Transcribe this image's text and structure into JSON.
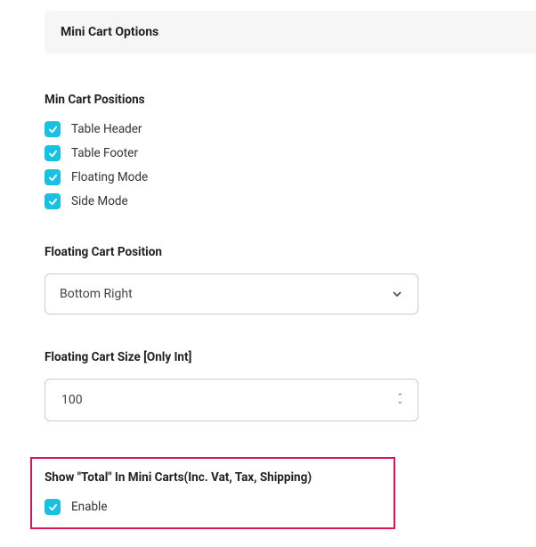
{
  "header": {
    "title": "Mini Cart Options"
  },
  "positions": {
    "label": "Min Cart Positions",
    "options": [
      {
        "label": "Table Header",
        "checked": true
      },
      {
        "label": "Table Footer",
        "checked": true
      },
      {
        "label": "Floating Mode",
        "checked": true
      },
      {
        "label": "Side Mode",
        "checked": true
      }
    ]
  },
  "floating_position": {
    "label": "Floating Cart Position",
    "value": "Bottom Right"
  },
  "floating_size": {
    "label": "Floating Cart Size [Only Int]",
    "value": "100"
  },
  "show_total": {
    "label": "Show \"Total\" In Mini Carts(Inc. Vat, Tax, Shipping)",
    "option_label": "Enable",
    "checked": true
  }
}
